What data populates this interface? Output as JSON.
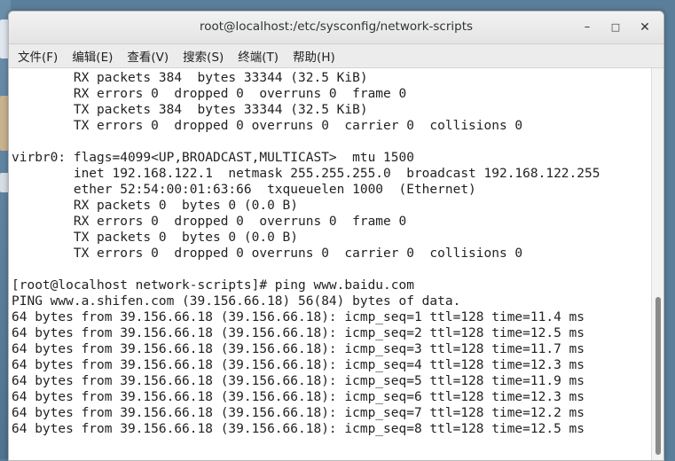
{
  "window": {
    "title": "root@localhost:/etc/sysconfig/network-scripts",
    "minimize_icon": "minimize-icon",
    "maximize_icon": "maximize-icon",
    "close_icon": "close-icon",
    "min_glyph": "–",
    "max_glyph": "□",
    "close_glyph": "✕"
  },
  "menubar": {
    "items": [
      {
        "label": "文件(F)"
      },
      {
        "label": "编辑(E)"
      },
      {
        "label": "查看(V)"
      },
      {
        "label": "搜索(S)"
      },
      {
        "label": "终端(T)"
      },
      {
        "label": "帮助(H)"
      }
    ]
  },
  "terminal": {
    "lines": [
      "        RX packets 384  bytes 33344 (32.5 KiB)",
      "        RX errors 0  dropped 0  overruns 0  frame 0",
      "        TX packets 384  bytes 33344 (32.5 KiB)",
      "        TX errors 0  dropped 0 overruns 0  carrier 0  collisions 0",
      "",
      "virbr0: flags=4099<UP,BROADCAST,MULTICAST>  mtu 1500",
      "        inet 192.168.122.1  netmask 255.255.255.0  broadcast 192.168.122.255",
      "        ether 52:54:00:01:63:66  txqueuelen 1000  (Ethernet)",
      "        RX packets 0  bytes 0 (0.0 B)",
      "        RX errors 0  dropped 0  overruns 0  frame 0",
      "        TX packets 0  bytes 0 (0.0 B)",
      "        TX errors 0  dropped 0 overruns 0  carrier 0  collisions 0",
      "",
      "[root@localhost network-scripts]# ping www.baidu.com",
      "PING www.a.shifen.com (39.156.66.18) 56(84) bytes of data.",
      "64 bytes from 39.156.66.18 (39.156.66.18): icmp_seq=1 ttl=128 time=11.4 ms",
      "64 bytes from 39.156.66.18 (39.156.66.18): icmp_seq=2 ttl=128 time=12.5 ms",
      "64 bytes from 39.156.66.18 (39.156.66.18): icmp_seq=3 ttl=128 time=11.7 ms",
      "64 bytes from 39.156.66.18 (39.156.66.18): icmp_seq=4 ttl=128 time=12.3 ms",
      "64 bytes from 39.156.66.18 (39.156.66.18): icmp_seq=5 ttl=128 time=11.9 ms",
      "64 bytes from 39.156.66.18 (39.156.66.18): icmp_seq=6 ttl=128 time=12.3 ms",
      "64 bytes from 39.156.66.18 (39.156.66.18): icmp_seq=7 ttl=128 time=12.2 ms",
      "64 bytes from 39.156.66.18 (39.156.66.18): icmp_seq=8 ttl=128 time=12.5 ms"
    ]
  }
}
